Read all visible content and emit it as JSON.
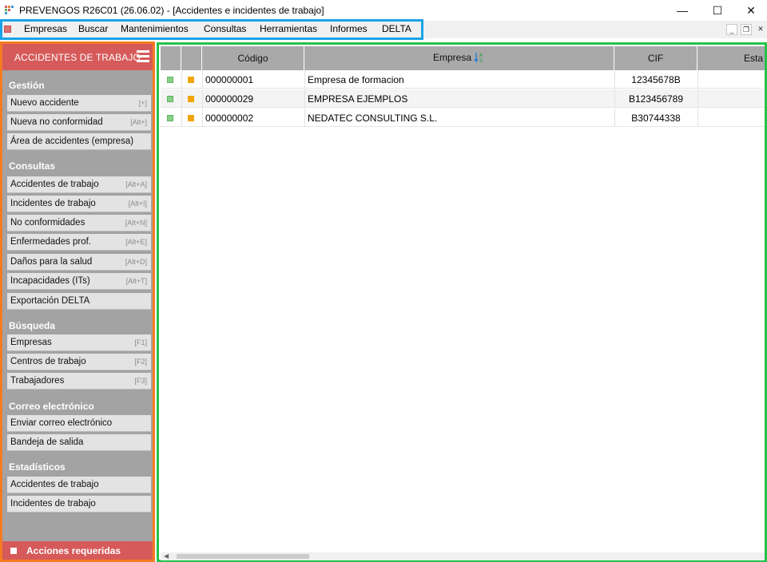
{
  "window": {
    "title": "PREVENGOS R26C01 (26.06.02) - [Accidentes e incidentes de trabajo]",
    "controls": {
      "minimize": "—",
      "maximize": "☐",
      "close": "✕"
    }
  },
  "menu": {
    "items": [
      "Empresas",
      "Buscar",
      "Mantenimientos",
      "Consultas",
      "Herramientas",
      "Informes",
      "DELTA"
    ],
    "mdi_controls": [
      "_",
      "❐",
      "✕"
    ]
  },
  "sidebar": {
    "title": "ACCIDENTES DE TRABAJO",
    "sections": [
      {
        "title": "Gestión",
        "items": [
          {
            "label": "Nuevo accidente",
            "key": "[+]"
          },
          {
            "label": "Nueva no conformidad",
            "key": "[Alt+]"
          },
          {
            "label": "Área de accidentes (empresa)",
            "key": ""
          }
        ]
      },
      {
        "title": "Consultas",
        "items": [
          {
            "label": "Accidentes de trabajo",
            "key": "[Alt+A]"
          },
          {
            "label": "Incidentes de trabajo",
            "key": "[Alt+I]"
          },
          {
            "label": "No conformidades",
            "key": "[Alt+N]"
          },
          {
            "label": "Enfermedades prof.",
            "key": "[Alt+E]"
          },
          {
            "label": "Daños para la salud",
            "key": "[Alt+D]"
          },
          {
            "label": "Incapacidades (ITs)",
            "key": "[Alt+T]"
          },
          {
            "label": "Exportación DELTA",
            "key": ""
          }
        ]
      },
      {
        "title": "Búsqueda",
        "items": [
          {
            "label": "Empresas",
            "key": "[F1]"
          },
          {
            "label": "Centros de trabajo",
            "key": "[F2]"
          },
          {
            "label": "Trabajadores",
            "key": "[F3]"
          }
        ]
      },
      {
        "title": "Correo electrónico",
        "items": [
          {
            "label": "Enviar correo electrónico",
            "key": ""
          },
          {
            "label": "Bandeja de salida",
            "key": ""
          }
        ]
      },
      {
        "title": "Estadísticos",
        "items": [
          {
            "label": "Accidentes de trabajo",
            "key": ""
          },
          {
            "label": "Incidentes de trabajo",
            "key": ""
          }
        ]
      }
    ],
    "footer": "Acciones requeridas"
  },
  "grid": {
    "columns": {
      "codigo": "Código",
      "empresa": "Empresa",
      "cif": "CIF",
      "estado": "Esta"
    },
    "rows": [
      {
        "codigo": "000000001",
        "empresa": "Empresa de formacion",
        "cif": "12345678B"
      },
      {
        "codigo": "000000029",
        "empresa": "EMPRESA EJEMPLOS",
        "cif": "B123456789"
      },
      {
        "codigo": "000000002",
        "empresa": "NEDATEC CONSULTING S.L.",
        "cif": "B30744338"
      }
    ]
  },
  "colors": {
    "sidebar_accent": "#d65a5a",
    "sidebar_bg": "#a3a3a3",
    "status_green": "#86d186",
    "status_orange": "#f0a500",
    "highlight_blue": "#1aa3e8",
    "highlight_orange": "#f47b20",
    "highlight_green": "#24c24a"
  }
}
